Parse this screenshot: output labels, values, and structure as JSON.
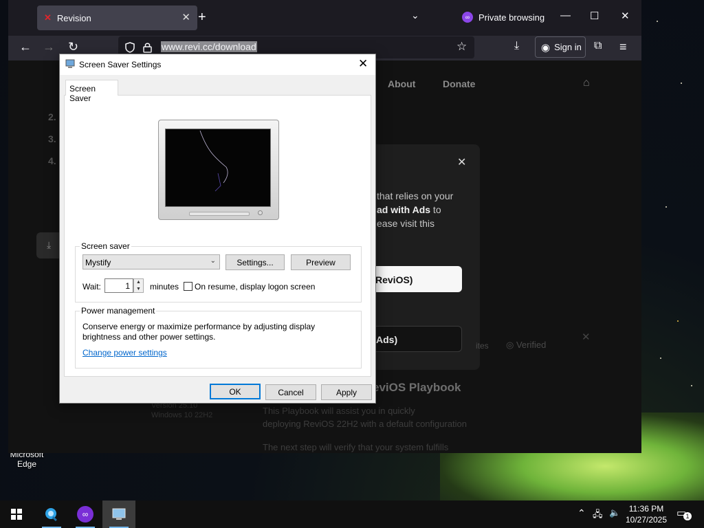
{
  "desktop": {
    "edge_label_line1": "Microsoft",
    "edge_label_line2": "Edge"
  },
  "browser": {
    "tab_title": "Revision",
    "private_label": "Private browsing",
    "url": "www.revi.cc/download",
    "sign_in_label": "Sign in"
  },
  "page": {
    "nav_about": "About",
    "nav_donate": "Donate",
    "list_2": "2.",
    "list_3": "3.",
    "list_4": "4.",
    "ad_line1": "that relies on your",
    "ad_line2_bold": "ad with Ads",
    "ad_line2_rest": " to",
    "ad_line3": "ease visit this",
    "btn_light": "ReviOS)",
    "btn_dark": "Ads)",
    "verified": "Verified",
    "sites": "ites",
    "playbook_title": "eviOS Playbook",
    "playbook_line1": "This Playbook will assist you in quickly",
    "playbook_line2": "deploying ReviOS 22H2 with a default configuration",
    "playbook_line3": "The next step will verify that your system fulfills",
    "side1": "Version 25.10",
    "side2": "Windows 10 22H2"
  },
  "dialog": {
    "title": "Screen Saver Settings",
    "tab": "Screen Saver",
    "screen_saver_group": "Screen saver",
    "selected_saver": "Mystify",
    "settings_button": "Settings...",
    "preview_button": "Preview",
    "wait_label": "Wait:",
    "wait_value": "1",
    "minutes_label": "minutes",
    "resume_label": "On resume, display logon screen",
    "resume_checked": false,
    "power_group": "Power management",
    "power_text_line1": "Conserve energy or maximize performance by adjusting display",
    "power_text_line2": "brightness and other power settings.",
    "power_link": "Change power settings",
    "ok_button": "OK",
    "cancel_button": "Cancel",
    "apply_button": "Apply"
  },
  "taskbar": {
    "time": "11:36 PM",
    "date": "10/27/2025",
    "notification_count": "1"
  },
  "colors": {
    "accent": "#0078d7",
    "link": "#0066cc",
    "private_purple": "#8b46e8"
  }
}
